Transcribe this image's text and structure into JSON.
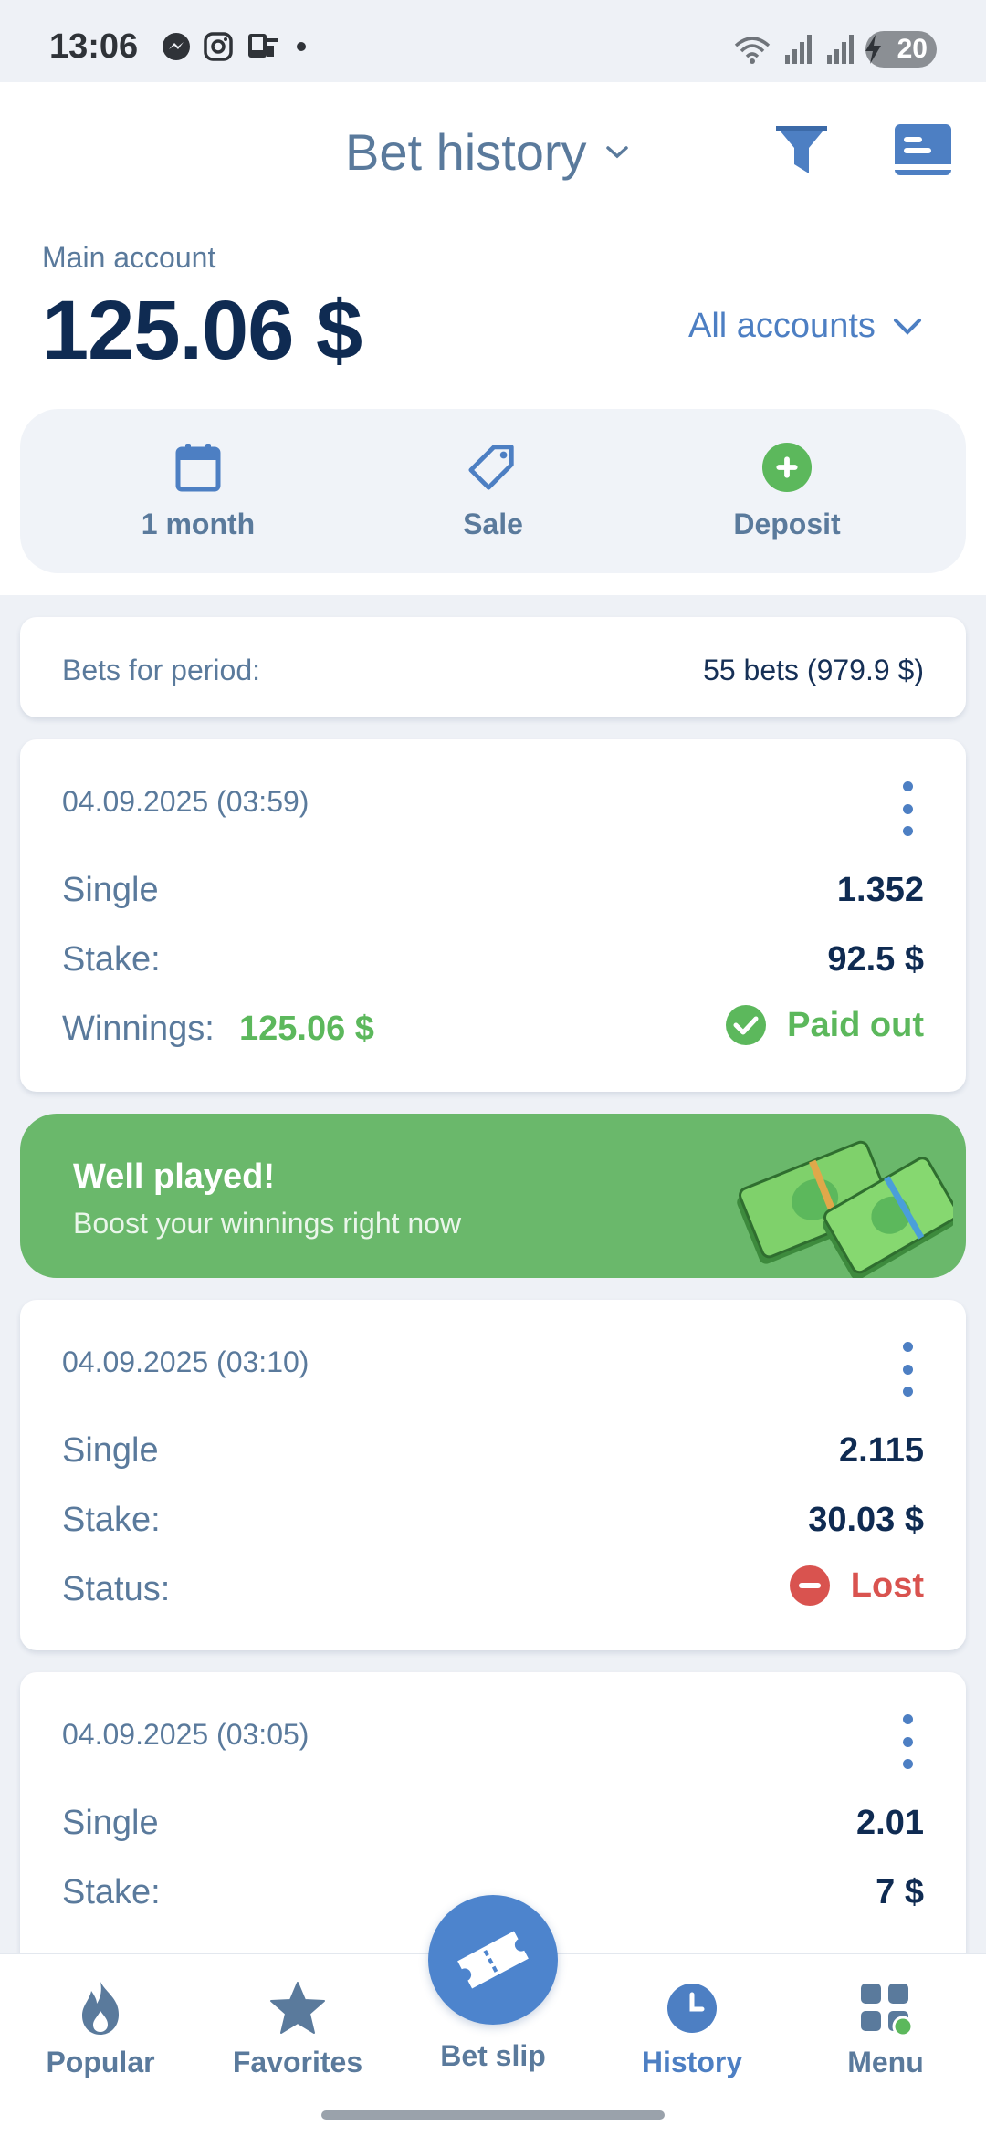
{
  "status_bar": {
    "time": "13:06",
    "battery": "20"
  },
  "header": {
    "title": "Bet history"
  },
  "account": {
    "label": "Main account",
    "balance": "125.06 $",
    "switcher": "All accounts"
  },
  "quick_actions": [
    {
      "label": "1 month",
      "icon": "calendar-icon"
    },
    {
      "label": "Sale",
      "icon": "tag-icon"
    },
    {
      "label": "Deposit",
      "icon": "plus-circle-icon"
    }
  ],
  "period": {
    "label": "Bets for period:",
    "value": "55 bets (979.9 $)"
  },
  "bets": [
    {
      "date": "04.09.2025 (03:59)",
      "type": "Single",
      "odds": "1.352",
      "stake_label": "Stake:",
      "stake": "92.5 $",
      "winnings_label": "Winnings:",
      "winnings": "125.06 $",
      "status": "Paid out"
    },
    {
      "date": "04.09.2025 (03:10)",
      "type": "Single",
      "odds": "2.115",
      "stake_label": "Stake:",
      "stake": "30.03 $",
      "status_label": "Status:",
      "status": "Lost"
    },
    {
      "date": "04.09.2025 (03:05)",
      "type": "Single",
      "odds": "2.01",
      "stake_label": "Stake:",
      "stake": "7 $"
    }
  ],
  "promo": {
    "title": "Well played!",
    "subtitle": "Boost your winnings right now"
  },
  "nav": {
    "popular": "Popular",
    "favorites": "Favorites",
    "bet_slip": "Bet slip",
    "history": "History",
    "menu": "Menu"
  },
  "colors": {
    "accent": "#4d7fc3",
    "win": "#5cb85c",
    "lost": "#d9534f",
    "promo": "#6ab86b",
    "text_dark": "#0f2b52"
  }
}
